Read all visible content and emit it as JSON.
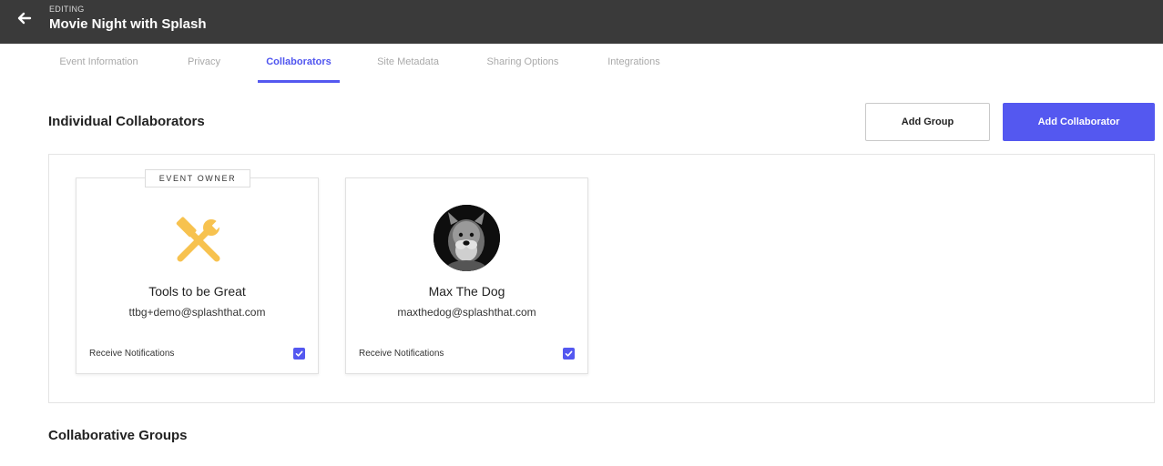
{
  "header": {
    "editing_label": "EDITING",
    "title": "Movie Night with Splash",
    "back_icon": "arrow-left-icon"
  },
  "tabs": [
    {
      "label": "Event Information",
      "active": false
    },
    {
      "label": "Privacy",
      "active": false
    },
    {
      "label": "Collaborators",
      "active": true
    },
    {
      "label": "Site Metadata",
      "active": false
    },
    {
      "label": "Sharing Options",
      "active": false
    },
    {
      "label": "Integrations",
      "active": false
    }
  ],
  "individual": {
    "title": "Individual Collaborators",
    "add_group_label": "Add Group",
    "add_collaborator_label": "Add Collaborator"
  },
  "collaborators": [
    {
      "badge": "EVENT OWNER",
      "icon": "tools-icon",
      "name": "Tools to be Great",
      "email": "ttbg+demo@splashthat.com",
      "notifications_label": "Receive Notifications",
      "notifications_checked": true
    },
    {
      "icon": "dog-avatar",
      "name": "Max The Dog",
      "email": "maxthedog@splashthat.com",
      "notifications_label": "Receive Notifications",
      "notifications_checked": true
    }
  ],
  "groups": {
    "title": "Collaborative Groups"
  },
  "colors": {
    "accent": "#5458f0",
    "header_bg": "#3a3a3a",
    "icon_yellow": "#f7c24f"
  }
}
